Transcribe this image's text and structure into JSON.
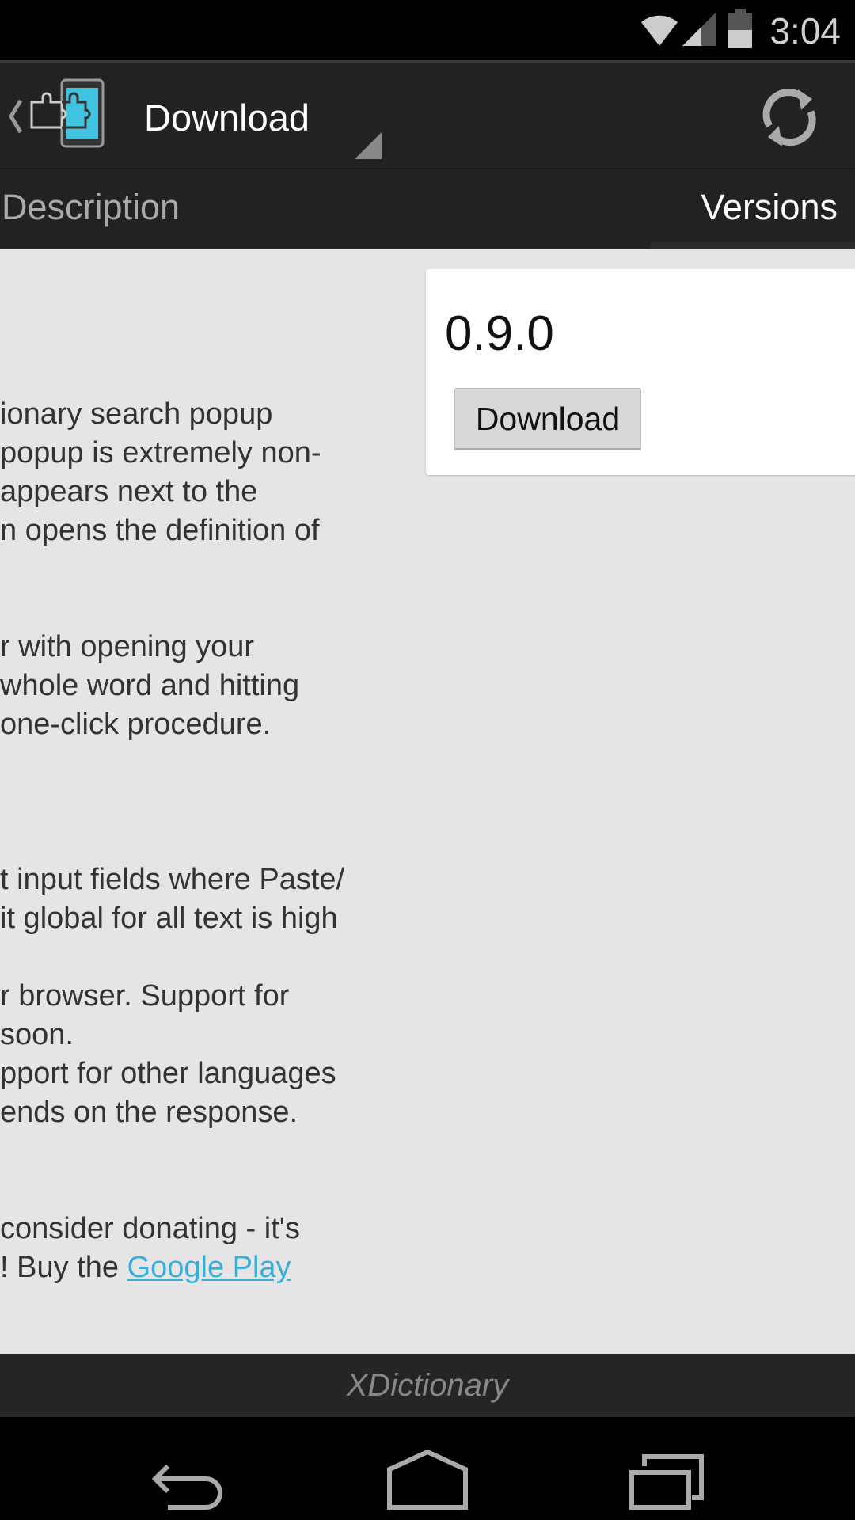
{
  "status_bar": {
    "time": "3:04",
    "icons": [
      "wifi-icon",
      "signal-icon",
      "battery-icon"
    ]
  },
  "action_bar": {
    "title": "Download",
    "icons": [
      "back-caret-icon",
      "xposed-app-icon",
      "spinner-triangle-icon",
      "refresh-icon"
    ]
  },
  "tabs": [
    {
      "label": "Description",
      "selected": false
    },
    {
      "label": "Versions",
      "selected": true
    }
  ],
  "versions": [
    {
      "version": "0.9.0",
      "button": "Download"
    }
  ],
  "description": {
    "lines": [
      "ionary search popup",
      " popup is extremely non-",
      " appears next to the",
      "n opens the definition of",
      "r with opening your",
      "whole word and hitting",
      " one-click procedure.",
      "t input fields where Paste/",
      " it global for all text is high",
      "r browser. Support for",
      "soon.",
      "pport for other languages",
      "ends on the response.",
      "consider donating - it's"
    ],
    "last_line_prefix": "! Buy the ",
    "link_text": "Google Play"
  },
  "footer": {
    "label": "XDictionary"
  },
  "nav_bar": {
    "icons": [
      "back-icon",
      "home-icon",
      "recents-icon"
    ]
  },
  "colors": {
    "accent": "#33b5e5",
    "link": "#3aaed8",
    "action_bar": "#222222",
    "content_bg": "#e5e5e5"
  }
}
